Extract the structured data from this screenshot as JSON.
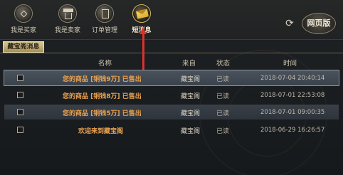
{
  "nav": [
    {
      "label": "我是买家",
      "icon": "coin-icon"
    },
    {
      "label": "我是卖家",
      "icon": "shop-icon"
    },
    {
      "label": "订单管理",
      "icon": "order-book-icon"
    },
    {
      "label": "短消息",
      "icon": "envelope-icon"
    }
  ],
  "web_button": "网页版",
  "refresh_icon": "refresh-icon",
  "sub_tab": "藏宝阁消息",
  "table": {
    "headers": {
      "name": "名称",
      "from": "来自",
      "status": "状态",
      "time": "时间"
    },
    "rows": [
      {
        "name": "您的商品 [铜钱9万] 已售出",
        "from": "藏宝阁",
        "status": "已读",
        "time": "2018-07-04  20:40:14"
      },
      {
        "name": "您的商品 [铜钱8万] 已售出",
        "from": "藏宝阁",
        "status": "已读",
        "time": "2018-07-01  22:53:08"
      },
      {
        "name": "您的商品 [铜钱5万] 已售出",
        "from": "藏宝阁",
        "status": "已读",
        "time": "2018-07-01  09:00:35"
      },
      {
        "name": "欢迎来到藏宝阁",
        "from": "藏宝阁",
        "status": "已读",
        "time": "2018-06-29  16:26:57"
      }
    ]
  },
  "colors": {
    "accent": "#e8a050",
    "arrow": "#e0302a"
  }
}
